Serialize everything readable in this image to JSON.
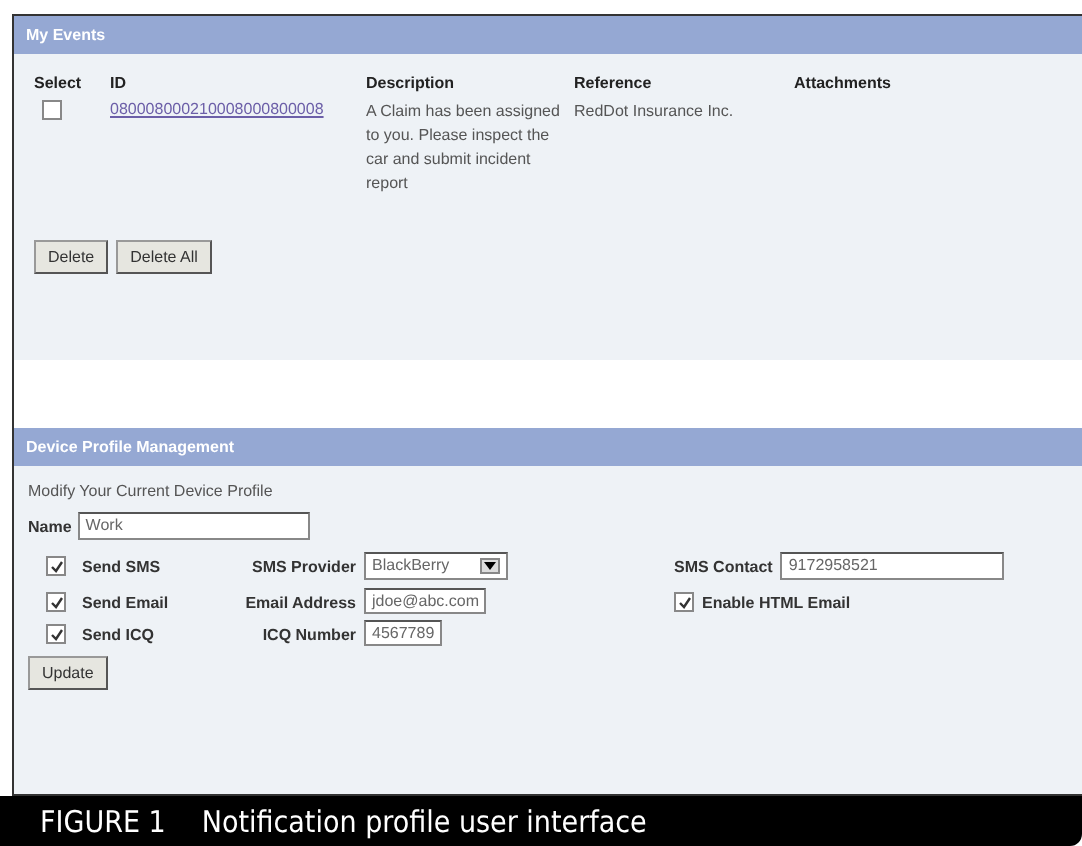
{
  "events": {
    "title": "My Events",
    "columns": [
      "Select",
      "ID",
      "Description",
      "Reference",
      "Attachments"
    ],
    "rows": [
      {
        "checked": false,
        "id": "080008000210008000800008",
        "description": "A Claim has been assigned to you. Please inspect the car and submit incident report",
        "reference": "RedDot Insurance Inc."
      }
    ],
    "buttons": [
      "Delete",
      "Delete All"
    ]
  },
  "profile": {
    "title": "Device Profile Management",
    "subtitle": "Modify Your Current Device Profile",
    "name_label": "Name",
    "name_value": "Work",
    "rows": [
      {
        "check_label": "Send SMS",
        "checked": true,
        "field": {
          "kind": "select",
          "label": "SMS Provider",
          "value": "BlackBerry"
        },
        "extra": {
          "kind": "field",
          "label": "SMS Contact",
          "value": "9172958521"
        }
      },
      {
        "check_label": "Send Email",
        "checked": true,
        "field": {
          "kind": "input",
          "label": "Email Address",
          "value": "jdoe@abc.com"
        },
        "extra": {
          "kind": "checkbox",
          "label": "Enable HTML Email",
          "checked": true
        }
      },
      {
        "check_label": "Send ICQ",
        "checked": true,
        "field": {
          "kind": "input",
          "label": "ICQ Number",
          "value": "4567789"
        }
      }
    ],
    "button": "Update"
  },
  "caption": {
    "label": "FIGURE 1",
    "text": "Notification profile user interface"
  }
}
